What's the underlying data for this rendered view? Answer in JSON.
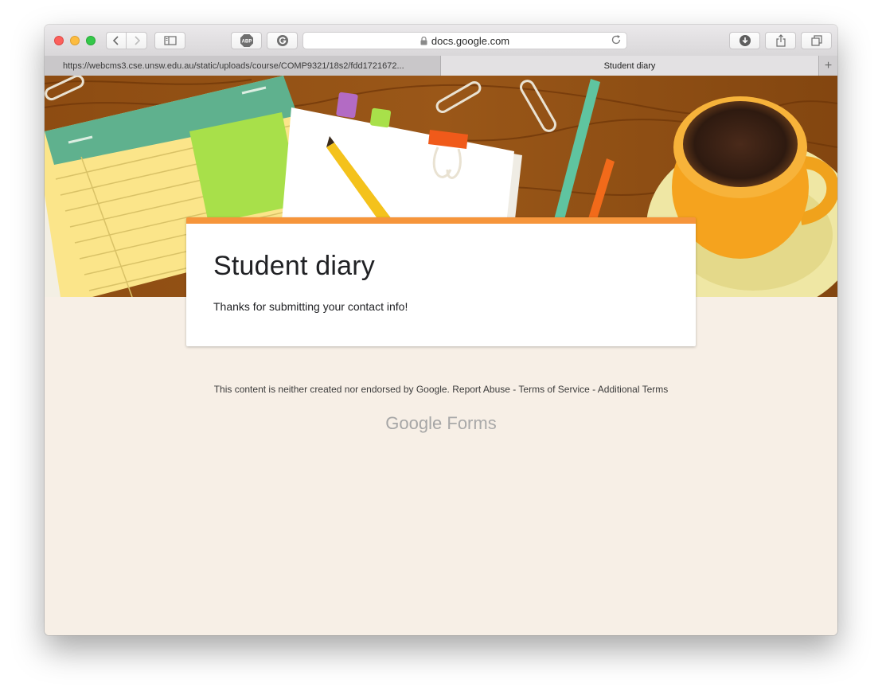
{
  "browser": {
    "address": "docs.google.com",
    "tabs": [
      {
        "title": "https://webcms3.cse.unsw.edu.au/static/uploads/course/COMP9321/18s2/fdd1721672...",
        "active": false
      },
      {
        "title": "Student diary",
        "active": true
      }
    ],
    "icons": {
      "back": "chevron-left-icon",
      "forward": "chevron-right-icon",
      "sidebar": "sidebar-icon",
      "adblock": "abp-icon",
      "extension": "grammarly-icon",
      "lock": "lock-icon",
      "reload": "reload-icon",
      "download": "download-icon",
      "share": "share-icon",
      "tabs_overview": "tabs-icon",
      "new_tab": "plus-icon"
    },
    "adblock_label": "ABP"
  },
  "form": {
    "title": "Student diary",
    "message": "Thanks for submitting your contact info!",
    "accent_color": "#f6953b"
  },
  "footer": {
    "disclaimer": "This content is neither created nor endorsed by Google.",
    "report_abuse": "Report Abuse",
    "sep1": "-",
    "terms": "Terms of Service",
    "sep2": "-",
    "additional_terms": "Additional Terms",
    "logo_google": "Google",
    "logo_forms": "Forms"
  },
  "colors": {
    "page_bg": "#f7efe6",
    "banner_wood": "#8a4b12"
  }
}
